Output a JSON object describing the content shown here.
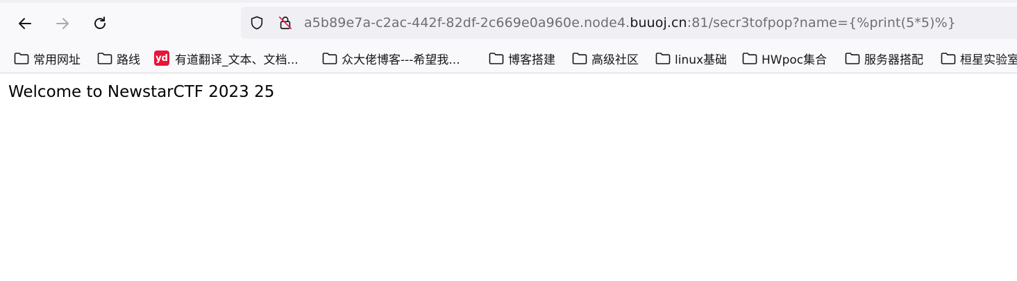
{
  "url": {
    "prefix": "a5b89e7a-c2ac-442f-82df-2c669e0a960e.node4.",
    "domain": "buuoj.cn",
    "suffix": ":81/secr3tofpop?name={%print(5*5)%}"
  },
  "bookmarks": [
    {
      "label": "常用网址",
      "icon": "folder-icon"
    },
    {
      "label": "路线",
      "icon": "folder-icon"
    },
    {
      "label": "有道翻译_文本、文档...",
      "icon": "youdao-icon",
      "icon_text": "yd"
    },
    {
      "label": "众大佬博客---希望我...",
      "icon": "folder-icon"
    },
    {
      "label": "博客搭建",
      "icon": "folder-icon"
    },
    {
      "label": "高级社区",
      "icon": "folder-icon"
    },
    {
      "label": "linux基础",
      "icon": "folder-icon"
    },
    {
      "label": "HWpoc集合",
      "icon": "folder-icon"
    },
    {
      "label": "服务器搭配",
      "icon": "folder-icon"
    },
    {
      "label": "桓星实验室",
      "icon": "folder-icon"
    }
  ],
  "page": {
    "text": "Welcome to NewstarCTF 2023 25"
  },
  "colors": {
    "youdao_red": "#e8143b",
    "url_text": "#6d6d75",
    "url_domain": "#15141a"
  }
}
